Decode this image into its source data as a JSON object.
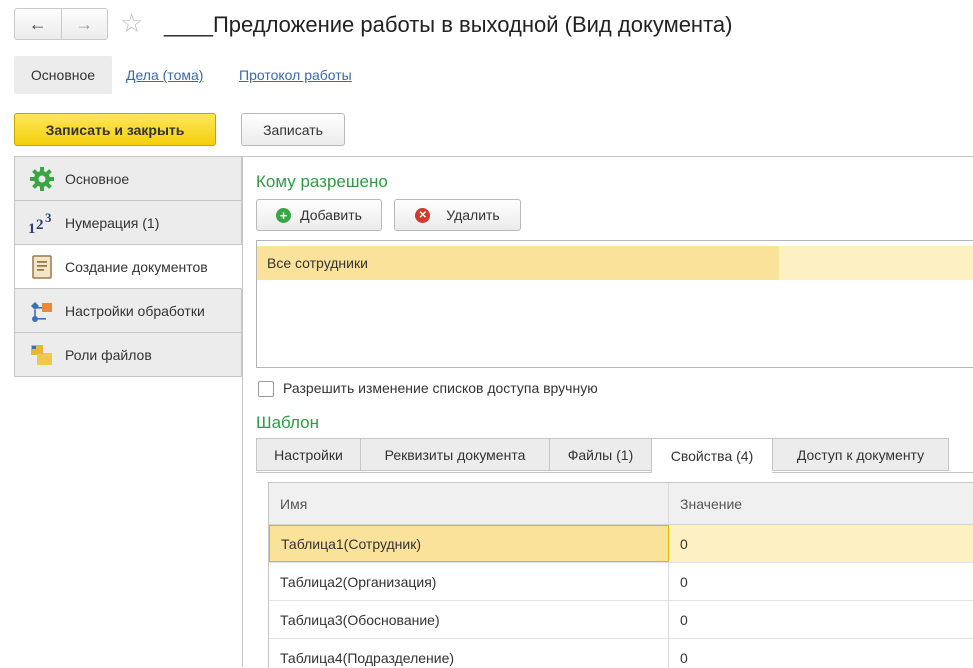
{
  "window": {
    "title": "____Предложение работы в выходной (Вид документа)"
  },
  "page_tabs": [
    {
      "label": "Основное"
    },
    {
      "label": "Дела (тома)"
    },
    {
      "label": "Протокол работы"
    }
  ],
  "toolbar": {
    "save_close_label": "Записать и закрыть",
    "save_label": "Записать"
  },
  "sections": [
    {
      "label": "Основное",
      "icon": "gear-icon"
    },
    {
      "label": "Нумерация (1)",
      "icon": "numbering-icon"
    },
    {
      "label": "Создание документов",
      "icon": "document-icon"
    },
    {
      "label": "Настройки обработки",
      "icon": "process-icon"
    },
    {
      "label": "Роли файлов",
      "icon": "folder-icon"
    }
  ],
  "access": {
    "title": "Кому разрешено",
    "add_label": "Добавить",
    "delete_label": "Удалить",
    "rows": [
      "Все сотрудники"
    ],
    "manual_checkbox_label": "Разрешить изменение списков доступа вручную"
  },
  "template": {
    "title": "Шаблон",
    "tabs": [
      {
        "label": "Настройки"
      },
      {
        "label": "Реквизиты документа"
      },
      {
        "label": "Файлы (1)"
      },
      {
        "label": "Свойства (4)"
      },
      {
        "label": "Доступ к документу"
      }
    ],
    "columns": [
      "Имя",
      "Значение"
    ],
    "rows": [
      {
        "name": "Таблица1(Сотрудник)",
        "value": "0"
      },
      {
        "name": "Таблица2(Организация)",
        "value": "0"
      },
      {
        "name": "Таблица3(Обоснование)",
        "value": "0"
      },
      {
        "name": "Таблица4(Подразделение)",
        "value": "0"
      }
    ]
  },
  "colors": {
    "accent_green": "#2e9b44",
    "primary_button": "#f4cf0c",
    "selection": "#fbe29a",
    "link": "#3d68a8"
  }
}
